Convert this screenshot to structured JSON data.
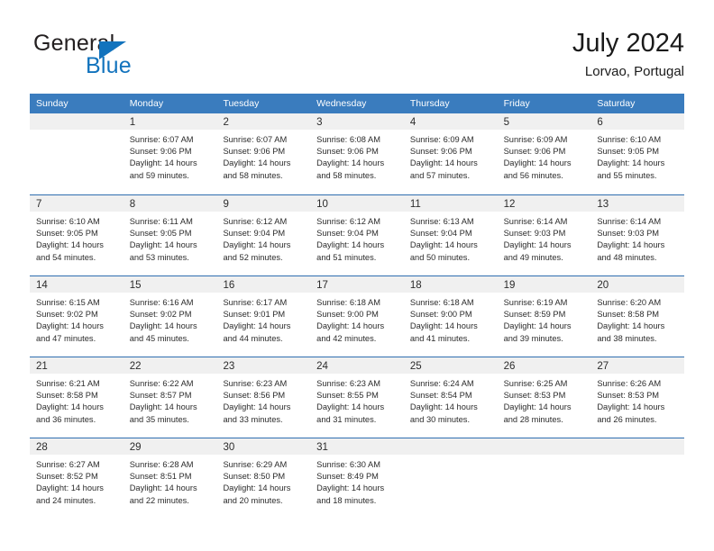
{
  "brand": {
    "line1": "General",
    "line2": "Blue"
  },
  "header": {
    "title": "July 2024",
    "subtitle": "Lorvao, Portugal"
  },
  "colors": {
    "header_blue": "#3a7cbe",
    "row_divider": "#2f6eb0",
    "brand_blue": "#1273bd",
    "date_band": "#f0f0f0"
  },
  "weekdays": [
    "Sunday",
    "Monday",
    "Tuesday",
    "Wednesday",
    "Thursday",
    "Friday",
    "Saturday"
  ],
  "weeks": [
    [
      {
        "day": "",
        "sunrise": "",
        "sunset": "",
        "daylight1": "",
        "daylight2": ""
      },
      {
        "day": "1",
        "sunrise": "Sunrise: 6:07 AM",
        "sunset": "Sunset: 9:06 PM",
        "daylight1": "Daylight: 14 hours",
        "daylight2": "and 59 minutes."
      },
      {
        "day": "2",
        "sunrise": "Sunrise: 6:07 AM",
        "sunset": "Sunset: 9:06 PM",
        "daylight1": "Daylight: 14 hours",
        "daylight2": "and 58 minutes."
      },
      {
        "day": "3",
        "sunrise": "Sunrise: 6:08 AM",
        "sunset": "Sunset: 9:06 PM",
        "daylight1": "Daylight: 14 hours",
        "daylight2": "and 58 minutes."
      },
      {
        "day": "4",
        "sunrise": "Sunrise: 6:09 AM",
        "sunset": "Sunset: 9:06 PM",
        "daylight1": "Daylight: 14 hours",
        "daylight2": "and 57 minutes."
      },
      {
        "day": "5",
        "sunrise": "Sunrise: 6:09 AM",
        "sunset": "Sunset: 9:06 PM",
        "daylight1": "Daylight: 14 hours",
        "daylight2": "and 56 minutes."
      },
      {
        "day": "6",
        "sunrise": "Sunrise: 6:10 AM",
        "sunset": "Sunset: 9:05 PM",
        "daylight1": "Daylight: 14 hours",
        "daylight2": "and 55 minutes."
      }
    ],
    [
      {
        "day": "7",
        "sunrise": "Sunrise: 6:10 AM",
        "sunset": "Sunset: 9:05 PM",
        "daylight1": "Daylight: 14 hours",
        "daylight2": "and 54 minutes."
      },
      {
        "day": "8",
        "sunrise": "Sunrise: 6:11 AM",
        "sunset": "Sunset: 9:05 PM",
        "daylight1": "Daylight: 14 hours",
        "daylight2": "and 53 minutes."
      },
      {
        "day": "9",
        "sunrise": "Sunrise: 6:12 AM",
        "sunset": "Sunset: 9:04 PM",
        "daylight1": "Daylight: 14 hours",
        "daylight2": "and 52 minutes."
      },
      {
        "day": "10",
        "sunrise": "Sunrise: 6:12 AM",
        "sunset": "Sunset: 9:04 PM",
        "daylight1": "Daylight: 14 hours",
        "daylight2": "and 51 minutes."
      },
      {
        "day": "11",
        "sunrise": "Sunrise: 6:13 AM",
        "sunset": "Sunset: 9:04 PM",
        "daylight1": "Daylight: 14 hours",
        "daylight2": "and 50 minutes."
      },
      {
        "day": "12",
        "sunrise": "Sunrise: 6:14 AM",
        "sunset": "Sunset: 9:03 PM",
        "daylight1": "Daylight: 14 hours",
        "daylight2": "and 49 minutes."
      },
      {
        "day": "13",
        "sunrise": "Sunrise: 6:14 AM",
        "sunset": "Sunset: 9:03 PM",
        "daylight1": "Daylight: 14 hours",
        "daylight2": "and 48 minutes."
      }
    ],
    [
      {
        "day": "14",
        "sunrise": "Sunrise: 6:15 AM",
        "sunset": "Sunset: 9:02 PM",
        "daylight1": "Daylight: 14 hours",
        "daylight2": "and 47 minutes."
      },
      {
        "day": "15",
        "sunrise": "Sunrise: 6:16 AM",
        "sunset": "Sunset: 9:02 PM",
        "daylight1": "Daylight: 14 hours",
        "daylight2": "and 45 minutes."
      },
      {
        "day": "16",
        "sunrise": "Sunrise: 6:17 AM",
        "sunset": "Sunset: 9:01 PM",
        "daylight1": "Daylight: 14 hours",
        "daylight2": "and 44 minutes."
      },
      {
        "day": "17",
        "sunrise": "Sunrise: 6:18 AM",
        "sunset": "Sunset: 9:00 PM",
        "daylight1": "Daylight: 14 hours",
        "daylight2": "and 42 minutes."
      },
      {
        "day": "18",
        "sunrise": "Sunrise: 6:18 AM",
        "sunset": "Sunset: 9:00 PM",
        "daylight1": "Daylight: 14 hours",
        "daylight2": "and 41 minutes."
      },
      {
        "day": "19",
        "sunrise": "Sunrise: 6:19 AM",
        "sunset": "Sunset: 8:59 PM",
        "daylight1": "Daylight: 14 hours",
        "daylight2": "and 39 minutes."
      },
      {
        "day": "20",
        "sunrise": "Sunrise: 6:20 AM",
        "sunset": "Sunset: 8:58 PM",
        "daylight1": "Daylight: 14 hours",
        "daylight2": "and 38 minutes."
      }
    ],
    [
      {
        "day": "21",
        "sunrise": "Sunrise: 6:21 AM",
        "sunset": "Sunset: 8:58 PM",
        "daylight1": "Daylight: 14 hours",
        "daylight2": "and 36 minutes."
      },
      {
        "day": "22",
        "sunrise": "Sunrise: 6:22 AM",
        "sunset": "Sunset: 8:57 PM",
        "daylight1": "Daylight: 14 hours",
        "daylight2": "and 35 minutes."
      },
      {
        "day": "23",
        "sunrise": "Sunrise: 6:23 AM",
        "sunset": "Sunset: 8:56 PM",
        "daylight1": "Daylight: 14 hours",
        "daylight2": "and 33 minutes."
      },
      {
        "day": "24",
        "sunrise": "Sunrise: 6:23 AM",
        "sunset": "Sunset: 8:55 PM",
        "daylight1": "Daylight: 14 hours",
        "daylight2": "and 31 minutes."
      },
      {
        "day": "25",
        "sunrise": "Sunrise: 6:24 AM",
        "sunset": "Sunset: 8:54 PM",
        "daylight1": "Daylight: 14 hours",
        "daylight2": "and 30 minutes."
      },
      {
        "day": "26",
        "sunrise": "Sunrise: 6:25 AM",
        "sunset": "Sunset: 8:53 PM",
        "daylight1": "Daylight: 14 hours",
        "daylight2": "and 28 minutes."
      },
      {
        "day": "27",
        "sunrise": "Sunrise: 6:26 AM",
        "sunset": "Sunset: 8:53 PM",
        "daylight1": "Daylight: 14 hours",
        "daylight2": "and 26 minutes."
      }
    ],
    [
      {
        "day": "28",
        "sunrise": "Sunrise: 6:27 AM",
        "sunset": "Sunset: 8:52 PM",
        "daylight1": "Daylight: 14 hours",
        "daylight2": "and 24 minutes."
      },
      {
        "day": "29",
        "sunrise": "Sunrise: 6:28 AM",
        "sunset": "Sunset: 8:51 PM",
        "daylight1": "Daylight: 14 hours",
        "daylight2": "and 22 minutes."
      },
      {
        "day": "30",
        "sunrise": "Sunrise: 6:29 AM",
        "sunset": "Sunset: 8:50 PM",
        "daylight1": "Daylight: 14 hours",
        "daylight2": "and 20 minutes."
      },
      {
        "day": "31",
        "sunrise": "Sunrise: 6:30 AM",
        "sunset": "Sunset: 8:49 PM",
        "daylight1": "Daylight: 14 hours",
        "daylight2": "and 18 minutes."
      },
      {
        "day": "",
        "sunrise": "",
        "sunset": "",
        "daylight1": "",
        "daylight2": ""
      },
      {
        "day": "",
        "sunrise": "",
        "sunset": "",
        "daylight1": "",
        "daylight2": ""
      },
      {
        "day": "",
        "sunrise": "",
        "sunset": "",
        "daylight1": "",
        "daylight2": ""
      }
    ]
  ]
}
